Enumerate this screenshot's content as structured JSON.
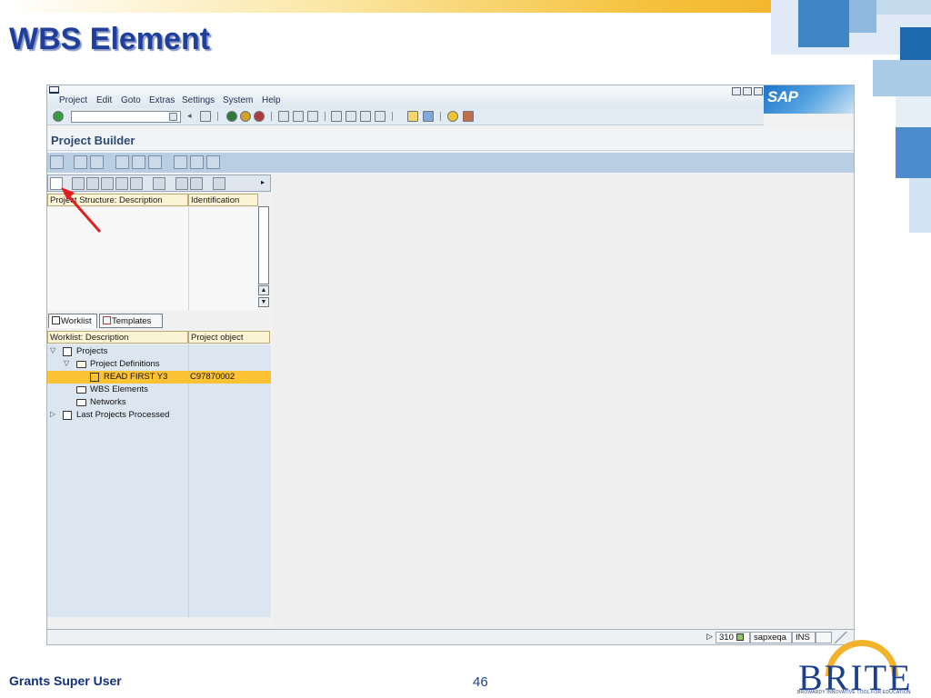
{
  "slide": {
    "title": "WBS Element",
    "footer_left": "Grants Super User",
    "page_number": "46",
    "brand_logo": "BRITE",
    "brand_tagline": "BROWARDY INNOVATIVE TOOL FOR EDUCATION"
  },
  "sap": {
    "menu": [
      {
        "label": "Project",
        "accel": "P"
      },
      {
        "label": "Edit",
        "accel": "E"
      },
      {
        "label": "Goto",
        "accel": "G"
      },
      {
        "label": "Extras",
        "accel": "a"
      },
      {
        "label": "Settings",
        "accel": "S"
      },
      {
        "label": "System",
        "accel": "y"
      },
      {
        "label": "Help",
        "accel": "H"
      }
    ],
    "logo": "SAP",
    "command_field": "",
    "screen_title": "Project Builder",
    "structure": {
      "col1": "Project Structure: Description",
      "col2": "Identification"
    },
    "tabs": {
      "worklist": "Worklist",
      "templates": "Templates"
    },
    "worklist": {
      "col1": "Worklist: Description",
      "col2": "Project object",
      "rows": [
        {
          "label": "Projects",
          "object": ""
        },
        {
          "label": "Project Definitions",
          "object": ""
        },
        {
          "label": "READ FIRST Y3",
          "object": "C97870002"
        },
        {
          "label": "WBS Elements",
          "object": ""
        },
        {
          "label": "Networks",
          "object": ""
        },
        {
          "label": "Last Projects Processed",
          "object": ""
        }
      ]
    },
    "status": {
      "client": "310",
      "server": "sapxeqa",
      "mode": "INS"
    }
  }
}
